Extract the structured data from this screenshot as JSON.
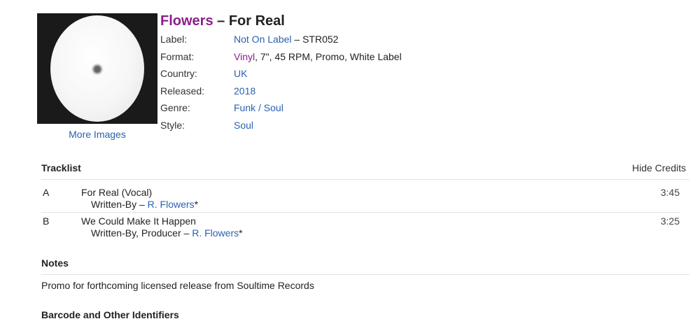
{
  "release": {
    "artist": "Flowers",
    "title_separator": "–",
    "title": "For Real",
    "more_images": "More Images",
    "profile": [
      {
        "label": "Label:",
        "parts": [
          {
            "text": "Not On Label",
            "link": true
          },
          {
            "text": " – STR052",
            "link": false
          }
        ]
      },
      {
        "label": "Format:",
        "parts": [
          {
            "text": "Vinyl",
            "link": true,
            "color": "#8b1f8a"
          },
          {
            "text": ", 7\", 45 RPM, Promo, White Label",
            "link": false
          }
        ]
      },
      {
        "label": "Country:",
        "parts": [
          {
            "text": "UK",
            "link": true
          }
        ]
      },
      {
        "label": "Released:",
        "parts": [
          {
            "text": "2018",
            "link": true
          }
        ]
      },
      {
        "label": "Genre:",
        "parts": [
          {
            "text": "Funk / Soul",
            "link": true
          }
        ]
      },
      {
        "label": "Style:",
        "parts": [
          {
            "text": "Soul",
            "link": true
          }
        ]
      }
    ]
  },
  "tracklist": {
    "heading": "Tracklist",
    "hide_credits": "Hide Credits",
    "tracks": [
      {
        "position": "A",
        "title": "For Real (Vocal)",
        "credit_role": "Written-By – ",
        "credit_name": "R. Flowers",
        "credit_suffix": "*",
        "duration": "3:45"
      },
      {
        "position": "B",
        "title": "We Could Make It Happen",
        "credit_role": "Written-By, Producer – ",
        "credit_name": "R. Flowers",
        "credit_suffix": "*",
        "duration": "3:25"
      }
    ]
  },
  "notes": {
    "heading": "Notes",
    "text": "Promo for forthcoming licensed release from Soultime Records"
  },
  "barcode": {
    "heading": "Barcode and Other Identifiers"
  },
  "colors": {
    "link": "#2a61b0",
    "artist_link": "#8b1f8a",
    "divider": "#e2e2e2"
  }
}
